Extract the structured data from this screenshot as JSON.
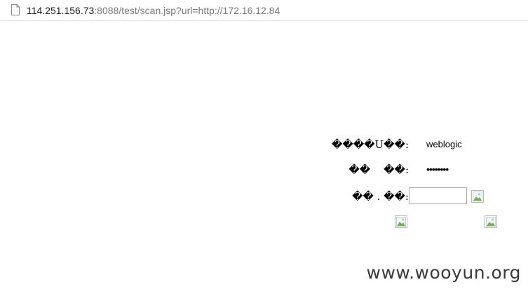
{
  "browser": {
    "url_host": "114.251.156.73",
    "url_rest": ":8088/test/scan.jsp?url=http://172.16.12.84",
    "page_icon": "document-icon"
  },
  "login_form": {
    "username_label": "����U��:",
    "username_value": "weblogic",
    "password_label": "��    ��:",
    "password_value": "••••••••",
    "captcha_label": "�� . ��:",
    "captcha_value": "",
    "captcha_image_icon": "broken-image-icon",
    "submit_image_icon": "broken-image-icon",
    "reset_image_icon": "broken-image-icon"
  },
  "watermark": {
    "text": "www.wooyun.org"
  }
}
